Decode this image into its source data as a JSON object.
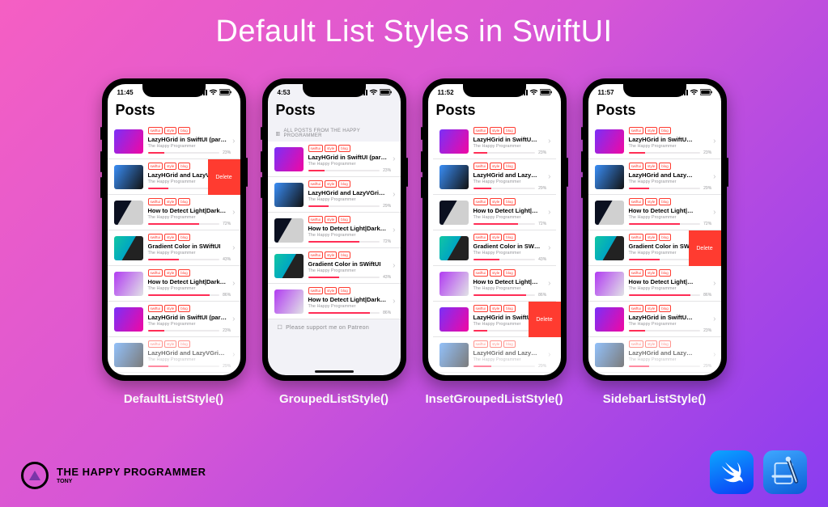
{
  "title": "Default List Styles in SwiftUI",
  "brand": {
    "name": "THE HAPPY",
    "name2": "PROGRAMMER",
    "author": "TONY"
  },
  "common": {
    "navTitle": "Posts",
    "deleteLabel": "Delete",
    "author": "The Happy Programmer",
    "tags": [
      "swiftui",
      "style",
      "blog"
    ]
  },
  "posts": [
    {
      "thumb": "t1",
      "title": "LazyHGrid in SwiftUI (par…",
      "titleShort": "LazyHGrid in SwiftU…",
      "pct": 23
    },
    {
      "thumb": "t2",
      "title": "LazyHGrid and LazyVGri…",
      "titleShort": "LazyHGrid and Lazy…",
      "pct": 29
    },
    {
      "thumb": "t3",
      "title": "How to Detect Light|Dark…",
      "titleShort": "How to Detect Light|…",
      "pct": 72
    },
    {
      "thumb": "t4",
      "title": "Gradient Color in SWiftUI",
      "titleShort": "Gradient Color in SW…",
      "pct": 43
    },
    {
      "thumb": "t5",
      "title": "How to Detect Light|Dark…",
      "titleShort": "How to Detect Light|…",
      "pct": 86
    },
    {
      "thumb": "t1",
      "title": "LazyHGrid in SwiftUI (par…",
      "titleShort": "LazyHGrid in SwiftU…",
      "pct": 23
    },
    {
      "thumb": "t2",
      "title": "LazyHGrid and LazyVGri…",
      "titleShort": "LazyHGrid and Lazy…",
      "pct": 29
    }
  ],
  "groupedSection": {
    "header": "ALL POSTS FROM THE HAPPY PROGRAMMER",
    "footer": "Please support me on Patreon"
  },
  "phones": [
    {
      "label": "DefaultListStyle()",
      "time": "11:45",
      "deleteRow": 1,
      "rowsShown": 7,
      "partialLast": true,
      "mode": "plain"
    },
    {
      "label": "GroupedListStyle()",
      "time": "4:53",
      "deleteRow": -1,
      "rowsShown": 5,
      "partialLast": false,
      "mode": "grouped"
    },
    {
      "label": "InsetGroupedListStyle()",
      "time": "11:52",
      "deleteRow": 5,
      "rowsShown": 7,
      "partialLast": true,
      "mode": "inset"
    },
    {
      "label": "SidebarListStyle()",
      "time": "11:57",
      "deleteRow": 3,
      "rowsShown": 7,
      "partialLast": true,
      "mode": "sidebar"
    }
  ]
}
